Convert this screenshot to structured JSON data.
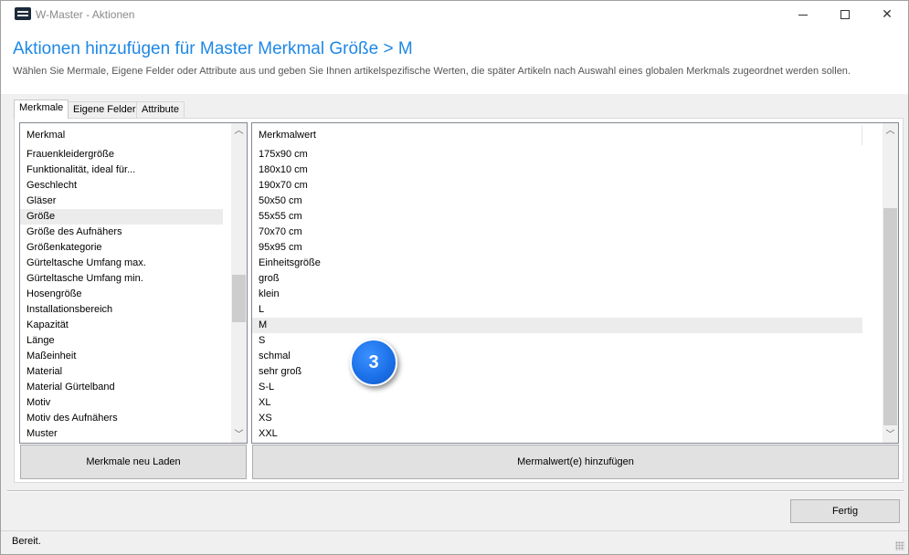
{
  "window": {
    "title": "W-Master - Aktionen",
    "icon": "app-icon"
  },
  "header": {
    "title": "Aktionen hinzufügen für Master Merkmal Größe > M",
    "subtitle": "Wählen Sie Mermale, Eigene Felder oder Attribute aus und geben Sie Ihnen artikelspezifische Werten, die später Artikeln nach Auswahl eines globalen Merkmals zugeordnet werden sollen."
  },
  "tabs": [
    {
      "label": "Merkmale",
      "active": true
    },
    {
      "label": "Eigene Felder",
      "active": false
    },
    {
      "label": "Attribute",
      "active": false
    }
  ],
  "left_list": {
    "header": "Merkmal",
    "selected": "Größe",
    "items": [
      "Frauenkleidergröße",
      "Funktionalität, ideal für...",
      "Geschlecht",
      "Gläser",
      "Größe",
      "Größe des Aufnähers",
      "Größenkategorie",
      "Gürteltasche Umfang max.",
      "Gürteltasche Umfang min.",
      "Hosengröße",
      "Installationsbereich",
      "Kapazität",
      "Länge",
      "Maßeinheit",
      "Material",
      "Material Gürtelband",
      "Motiv",
      "Motiv des Aufnähers",
      "Muster"
    ]
  },
  "right_list": {
    "header": "Merkmalwert",
    "selected": "M",
    "items": [
      "175x90 cm",
      "180x10 cm",
      "190x70 cm",
      "50x50 cm",
      "55x55 cm",
      "70x70 cm",
      "95x95 cm",
      "Einheitsgröße",
      "groß",
      "klein",
      "L",
      "M",
      "S",
      "schmal",
      "sehr groß",
      "S-L",
      "XL",
      "XS",
      "XXL"
    ]
  },
  "buttons": {
    "reload": "Merkmale neu Laden",
    "add": "Mermalwert(e) hinzufügen",
    "done": "Fertig"
  },
  "status": {
    "text": "Bereit."
  },
  "badge": {
    "number": "3",
    "color": "#1a6ee6"
  },
  "colors": {
    "accent": "#1e88e5"
  }
}
